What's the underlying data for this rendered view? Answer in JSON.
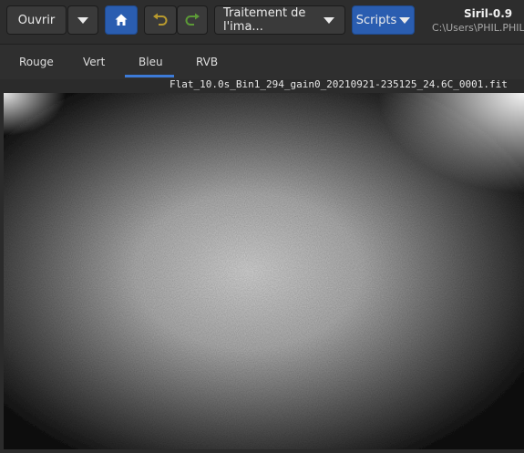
{
  "toolbar": {
    "open_label": "Ouvrir",
    "processing_label": "Traitement de l'ima...",
    "scripts_label": "Scripts",
    "accent_color": "#2a5db0"
  },
  "app": {
    "name": "Siril-0.9",
    "path": "C:\\Users\\PHIL.PHIL"
  },
  "tabs": [
    {
      "label": "Rouge"
    },
    {
      "label": "Vert"
    },
    {
      "label": "Bleu",
      "active": true
    },
    {
      "label": "RVB"
    }
  ],
  "image": {
    "filename": "Flat_10.0s_Bin1_294_gain0_20210921-235125_24.6C_0001.fit"
  },
  "icons": {
    "open_menu": "chevron-down-icon",
    "home": "home-icon",
    "undo": "undo-icon",
    "redo": "redo-icon",
    "processing_menu": "chevron-down-icon",
    "scripts_menu": "chevron-down-icon"
  }
}
